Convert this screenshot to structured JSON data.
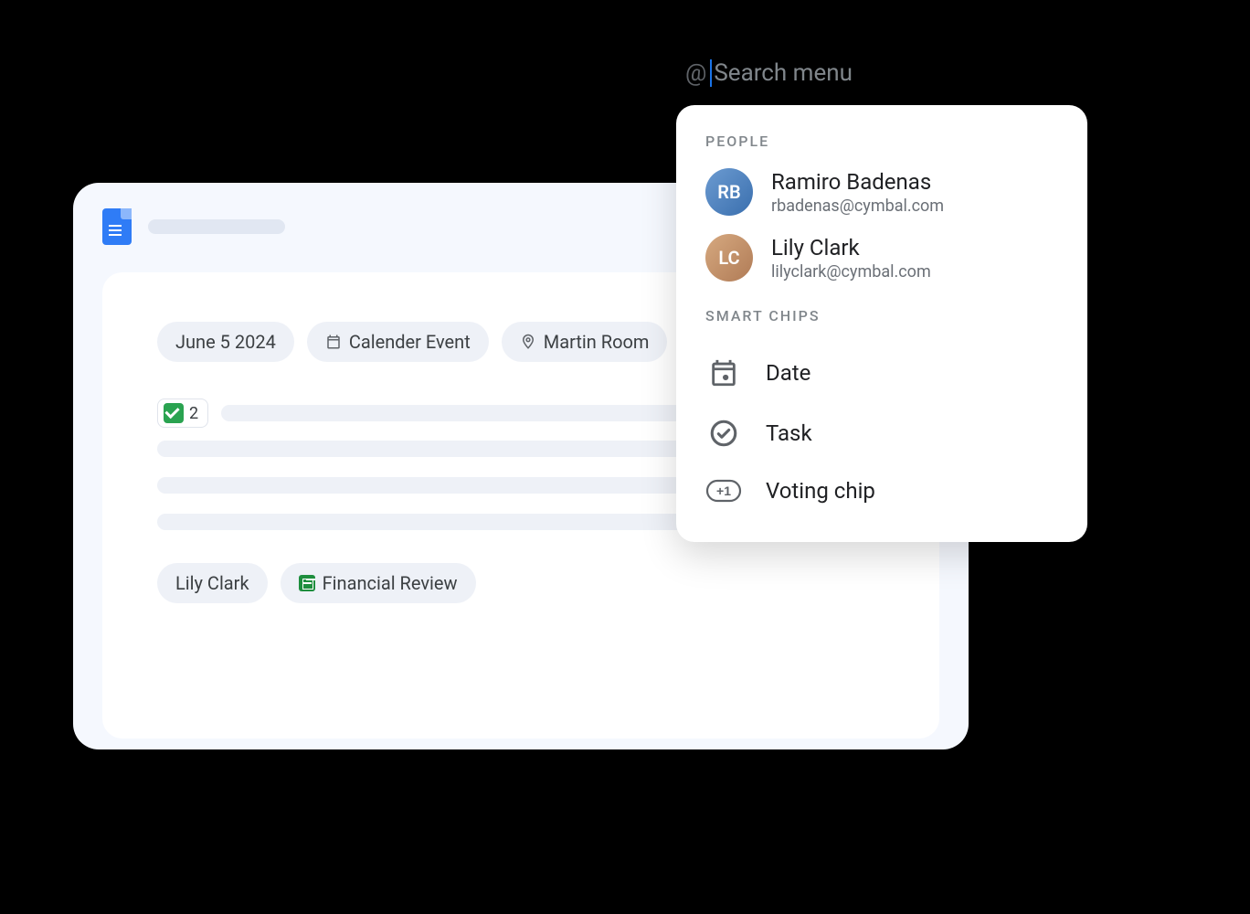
{
  "search": {
    "at_symbol": "@",
    "placeholder": "Search menu"
  },
  "menu": {
    "people_header": "PEOPLE",
    "people": [
      {
        "name": "Ramiro Badenas",
        "email": "rbadenas@cymbal.com",
        "initials": "RB"
      },
      {
        "name": "Lily Clark",
        "email": "lilyclark@cymbal.com",
        "initials": "LC"
      }
    ],
    "smart_chips_header": "SMART CHIPS",
    "smart_chips": [
      {
        "label": "Date",
        "icon": "calendar-icon"
      },
      {
        "label": "Task",
        "icon": "task-icon"
      },
      {
        "label": "Voting chip",
        "icon": "plus-one-icon"
      }
    ]
  },
  "document": {
    "chips_row1": {
      "date": "June 5 2024",
      "event": "Calender Event",
      "location": "Martin Room"
    },
    "vote_count": "2",
    "chips_row2": {
      "person": "Lily Clark",
      "file": "Financial Review"
    }
  }
}
